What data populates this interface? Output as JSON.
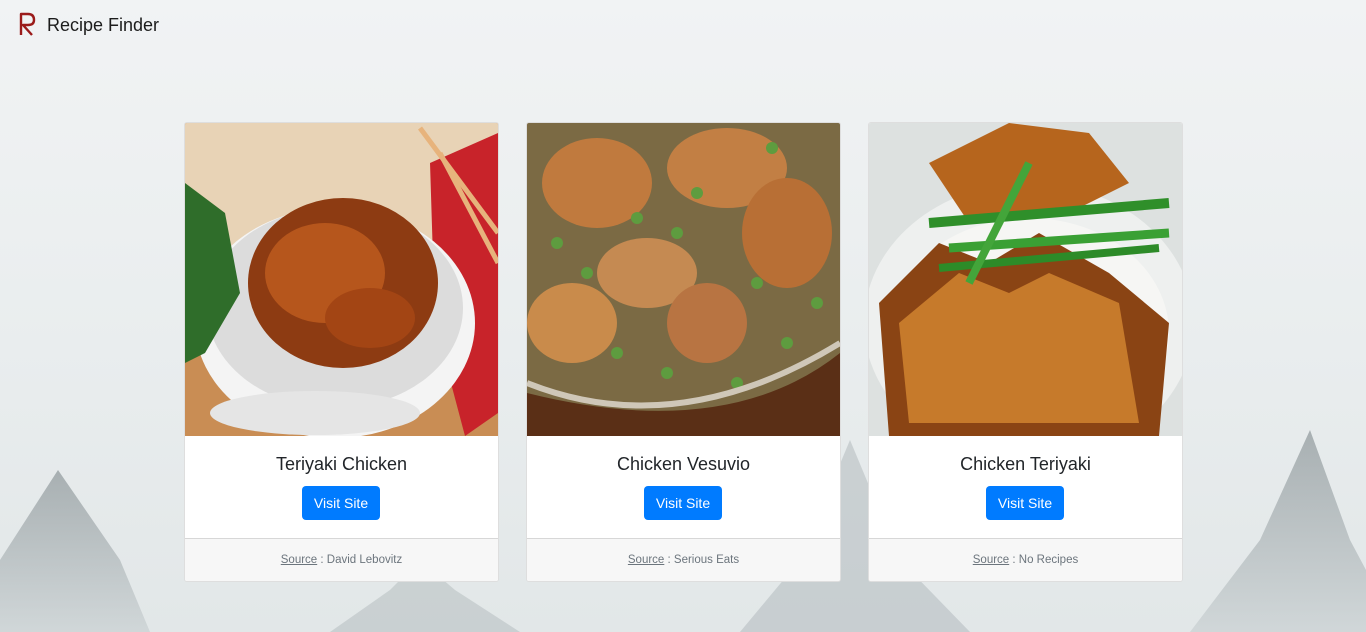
{
  "brand": {
    "logo_letter": "R",
    "name": "Recipe Finder",
    "logo_color": "#9b1b1b"
  },
  "colors": {
    "button": "#007bff",
    "footer_bg": "#f7f7f7"
  },
  "recipes": [
    {
      "title": "Teriyaki Chicken",
      "button_label": "Visit Site",
      "source_label": "Source",
      "separator": " : ",
      "source_name": "David Lebovitz",
      "image": "teriyaki-chicken-bowl-photo"
    },
    {
      "title": "Chicken Vesuvio",
      "button_label": "Visit Site",
      "source_label": "Source",
      "separator": " : ",
      "source_name": "Serious Eats",
      "image": "chicken-vesuvio-skillet-photo"
    },
    {
      "title": "Chicken Teriyaki",
      "button_label": "Visit Site",
      "source_label": "Source",
      "separator": " : ",
      "source_name": "No Recipes",
      "image": "chicken-teriyaki-rice-bowl-photo"
    }
  ]
}
